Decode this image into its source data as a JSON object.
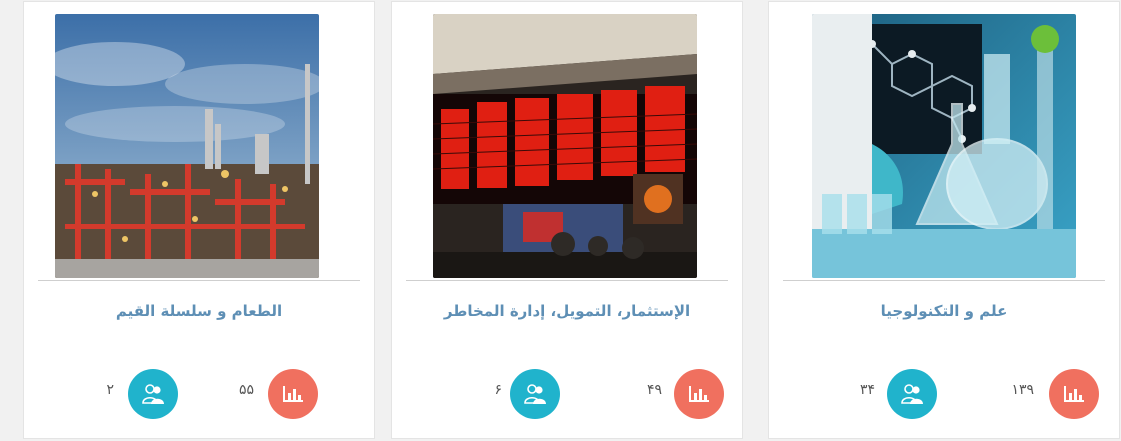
{
  "cards": [
    {
      "title": "علم و التكنولوجيا",
      "chart_count": "۱۳۹",
      "people_count": "۳۴",
      "image": "laboratory-glassware"
    },
    {
      "title": "الإستثمار، التمويل، إدارة المخاطر",
      "chart_count": "۴۹",
      "people_count": "۶",
      "image": "stock-exchange-board"
    },
    {
      "title": "الطعام و سلسلة القيم",
      "chart_count": "۵۵",
      "people_count": "۲",
      "image": "industrial-refinery"
    }
  ],
  "colors": {
    "chart_button": "#f0705f",
    "people_button": "#20b3cc",
    "title": "#5e8fb5"
  },
  "icons": {
    "chart": "bar-chart-icon",
    "people": "users-icon"
  }
}
